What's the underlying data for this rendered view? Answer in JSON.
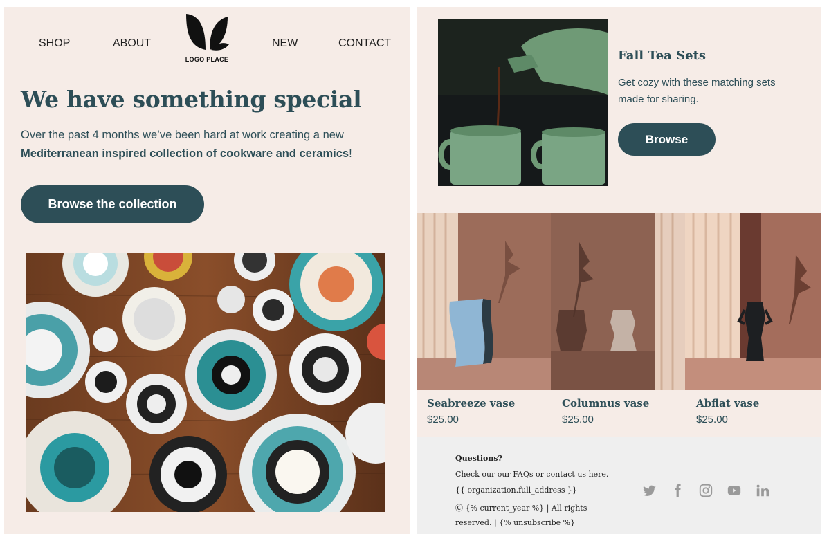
{
  "nav": {
    "shop": "SHOP",
    "about": "ABOUT",
    "new": "NEW",
    "contact": "CONTACT",
    "logo_text": "LOGO PLACE"
  },
  "hero": {
    "headline": "We have something special",
    "intro_text": "Over the past 4 months we’ve been hard at work creating a new",
    "intro_link": "Mediterranean inspired collection of cookware and ceramics",
    "intro_end": "!",
    "button": "Browse the collection"
  },
  "feature": {
    "title": "Fall Tea Sets",
    "description": "Get cozy with these matching sets made for sharing.",
    "button": "Browse"
  },
  "products": [
    {
      "name": "Seabreeze vase",
      "price": "$25.00"
    },
    {
      "name": "Columnus vase",
      "price": "$25.00"
    },
    {
      "name": "Abflat vase",
      "price": "$25.00"
    }
  ],
  "footer": {
    "title": "Questions?",
    "line1": "Check our our FAQs or contact us here.",
    "line2": "{{ organization.full_address }}",
    "line3": "Ⓒ {% current_year %} | All rights",
    "line4": "reserved. | {% unsubscribe %} |",
    "social_icons": [
      "twitter-icon",
      "facebook-icon",
      "instagram-icon",
      "youtube-icon",
      "linkedin-icon"
    ]
  },
  "colors": {
    "accent": "#2d4e57",
    "panel_bg": "#f6ece7",
    "footer_bg": "#efefef",
    "icon_gray": "#9a9a9a"
  }
}
